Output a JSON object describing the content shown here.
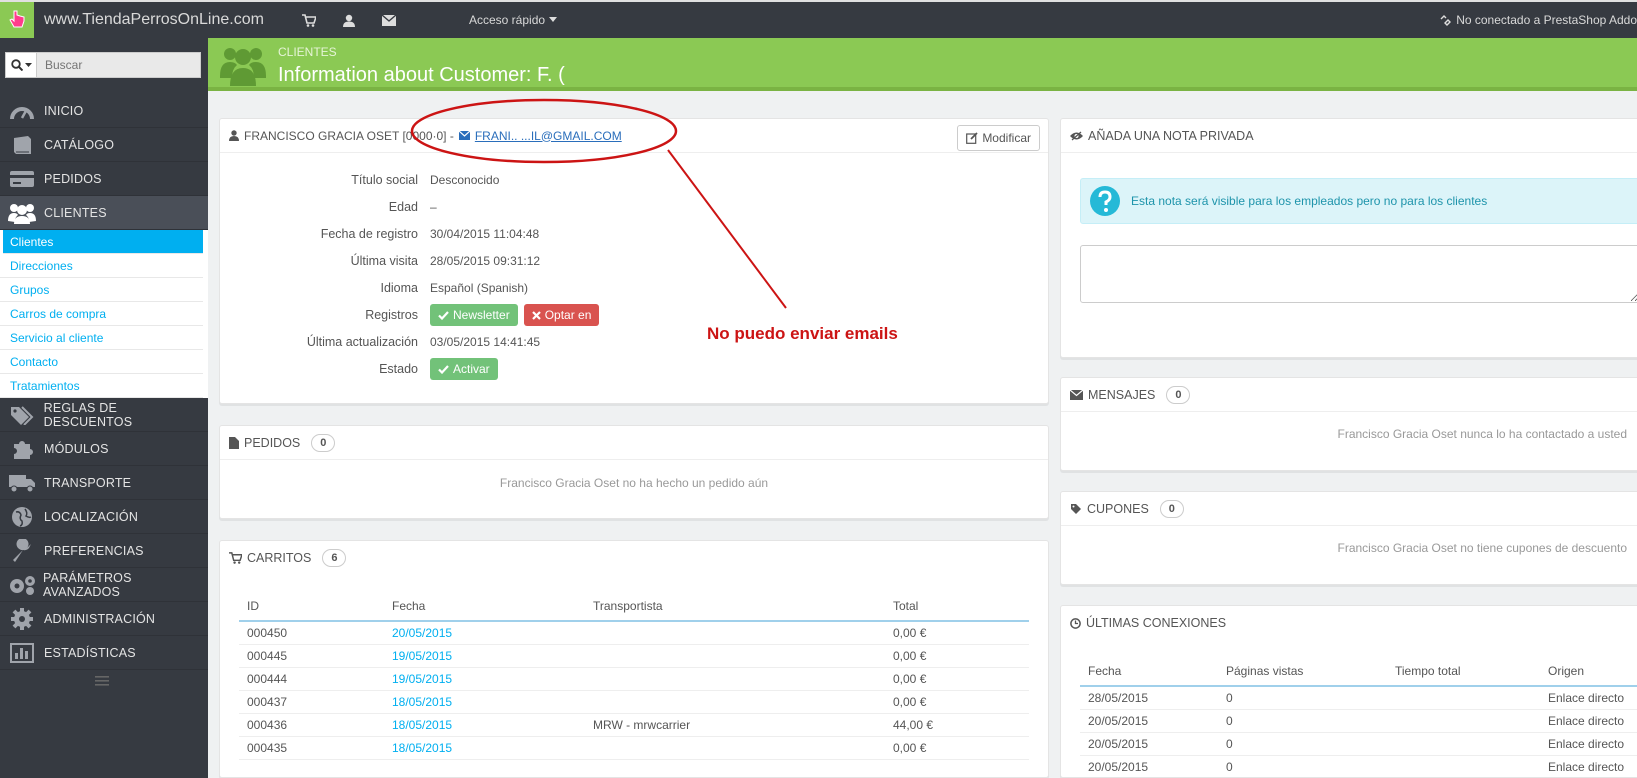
{
  "topbar": {
    "shop_name": "www.TiendaPerrosOnLine.com",
    "quick_access": "Acceso rápido",
    "connection_status": "No conectado a PrestaShop Addo"
  },
  "sidebar": {
    "search_placeholder": "Buscar",
    "menu": [
      {
        "label": "INICIO",
        "icon": "dashboard-icon"
      },
      {
        "label": "CATÁLOGO",
        "icon": "book-icon"
      },
      {
        "label": "PEDIDOS",
        "icon": "credit-card-icon"
      },
      {
        "label": "CLIENTES",
        "icon": "users-icon",
        "active": true
      }
    ],
    "submenu": [
      "Clientes",
      "Direcciones",
      "Grupos",
      "Carros de compra",
      "Servicio al cliente",
      "Contacto",
      "Tratamientos"
    ],
    "menu_after": [
      {
        "label": "REGLAS DE DESCUENTOS",
        "icon": "tags-icon"
      },
      {
        "label": "MÓDULOS",
        "icon": "puzzle-icon"
      },
      {
        "label": "TRANSPORTE",
        "icon": "truck-icon"
      },
      {
        "label": "LOCALIZACIÓN",
        "icon": "globe-icon"
      },
      {
        "label": "PREFERENCIAS",
        "icon": "wrench-icon"
      },
      {
        "label": "PARÁMETROS AVANZADOS",
        "icon": "gears-icon"
      },
      {
        "label": "ADMINISTRACIÓN",
        "icon": "gear-icon"
      },
      {
        "label": "ESTADÍSTICAS",
        "icon": "bar-chart-icon"
      }
    ]
  },
  "header": {
    "breadcrumb": "CLIENTES",
    "title": "Information about Customer: F. ("
  },
  "customer": {
    "heading": "FRANCISCO GRACIA OSET [0000·0] -",
    "email": "FRANI..              ...IL@GMAIL.COM",
    "edit_label": "Modificar",
    "rows": [
      {
        "label": "Título social",
        "value": "Desconocido"
      },
      {
        "label": "Edad",
        "value": "–"
      },
      {
        "label": "Fecha de registro",
        "value": "30/04/2015 11:04:48"
      },
      {
        "label": "Última visita",
        "value": "28/05/2015 09:31:12"
      },
      {
        "label": "Idioma",
        "value": "Español (Spanish)"
      },
      {
        "label": "Registros",
        "value": ""
      },
      {
        "label": "Última actualización",
        "value": "03/05/2015 14:41:45"
      },
      {
        "label": "Estado",
        "value": ""
      }
    ],
    "newsletter_label": "Newsletter",
    "optin_label": "Optar en",
    "status_label": "Activar"
  },
  "annotation": "No puedo enviar emails",
  "orders": {
    "heading": "PEDIDOS",
    "count": "0",
    "empty": "Francisco Gracia Oset no ha hecho un pedido aún"
  },
  "carts": {
    "heading": "CARRITOS",
    "count": "6",
    "columns": [
      "ID",
      "Fecha",
      "Transportista",
      "Total"
    ],
    "rows": [
      [
        "000450",
        "20/05/2015",
        "",
        "0,00 €"
      ],
      [
        "000445",
        "19/05/2015",
        "",
        "0,00 €"
      ],
      [
        "000444",
        "19/05/2015",
        "",
        "0,00 €"
      ],
      [
        "000437",
        "18/05/2015",
        "",
        "0,00 €"
      ],
      [
        "000436",
        "18/05/2015",
        "MRW - mrwcarrier",
        "44,00 €"
      ],
      [
        "000435",
        "18/05/2015",
        "",
        "0,00 €"
      ]
    ]
  },
  "private_note": {
    "heading": "AÑADA UNA NOTA PRIVADA",
    "info": "Esta nota será visible para los empleados pero no para los clientes"
  },
  "messages": {
    "heading": "MENSAJES",
    "count": "0",
    "empty": "Francisco Gracia Oset nunca lo ha contactado a usted"
  },
  "coupons": {
    "heading": "CUPONES",
    "count": "0",
    "empty": "Francisco Gracia Oset no tiene cupones de descuento"
  },
  "connections": {
    "heading": "ÚLTIMAS CONEXIONES",
    "columns": [
      "Fecha",
      "Páginas vistas",
      "Tiempo total",
      "Origen"
    ],
    "rows": [
      [
        "28/05/2015",
        "0",
        "",
        "Enlace directo"
      ],
      [
        "20/05/2015",
        "0",
        "",
        "Enlace directo"
      ],
      [
        "20/05/2015",
        "0",
        "",
        "Enlace directo"
      ],
      [
        "20/05/2015",
        "0",
        "",
        "Enlace directo"
      ]
    ]
  },
  "colors": {
    "accent_green": "#8bc954",
    "link_blue": "#00aff0",
    "dark_bg": "#363a41",
    "annotation_red": "#cc1414"
  }
}
